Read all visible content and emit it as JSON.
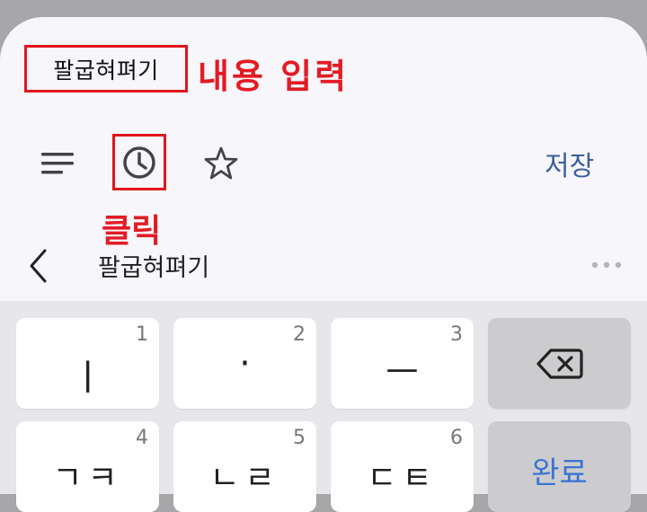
{
  "title": "팔굽혀펴기",
  "annotations": {
    "input": "내용 입력",
    "click": "클릭"
  },
  "toolbar": {
    "menu_icon": "menu-icon",
    "history_icon": "clock-icon",
    "favorite_icon": "star-icon",
    "save_label": "저장"
  },
  "suggestion": {
    "text": "팔굽혀펴기",
    "back_icon": "chevron-left-icon",
    "more_icon": "more-horizontal-icon"
  },
  "keyboard": {
    "row1": [
      {
        "main": "ㅣ",
        "num": "1"
      },
      {
        "main": "·",
        "num": "2"
      },
      {
        "main": "ㅡ",
        "num": "3"
      }
    ],
    "backspace_icon": "backspace-icon",
    "row2": [
      {
        "main": "ㄱㅋ",
        "num": "4"
      },
      {
        "main": "ㄴㄹ",
        "num": "5"
      },
      {
        "main": "ㄷㅌ",
        "num": "6"
      }
    ],
    "done_label": "완료"
  },
  "colors": {
    "annotation_red": "#e31b23",
    "accent_blue": "#3c5f9c",
    "done_blue": "#3c74d4"
  }
}
